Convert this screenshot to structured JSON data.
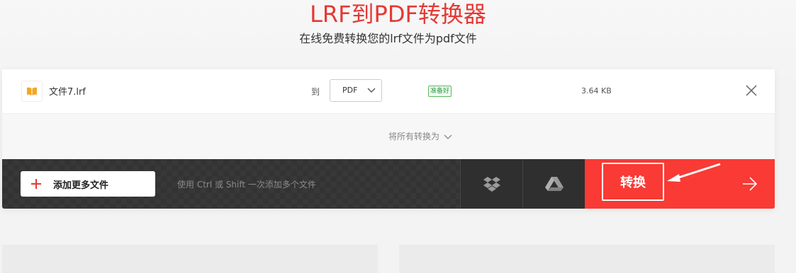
{
  "header": {
    "title": "LRF到PDF转换器",
    "subtitle": "在线免费转换您的lrf文件为pdf文件"
  },
  "file": {
    "name": "文件7.lrf",
    "to_label": "到",
    "format": "PDF",
    "status": "准备好",
    "size": "3.64 KB",
    "icon": "book-icon"
  },
  "convert_all": {
    "label": "将所有转换为"
  },
  "actions": {
    "add_label": "添加更多文件",
    "hint": "使用 Ctrl 或 Shift 一次添加多个文件",
    "convert_label": "转换",
    "cloud_services": [
      "dropbox-icon",
      "google-drive-icon"
    ]
  },
  "colors": {
    "accent": "#f93a35",
    "title": "#e53935",
    "status": "#2e9b4a"
  }
}
